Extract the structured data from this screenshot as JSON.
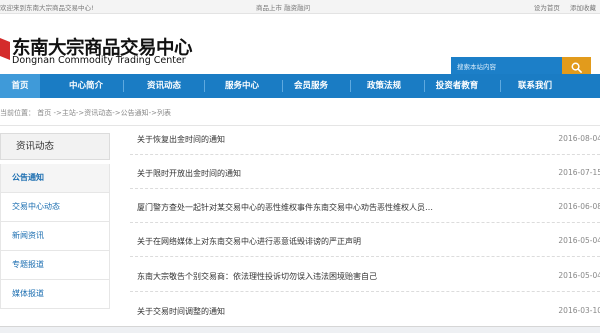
{
  "topbar": {
    "welcome": "欢迎来到东南大宗商品交易中心!",
    "center": "商品上市  融资融问",
    "links": [
      "设为首页",
      "添加收藏"
    ]
  },
  "header": {
    "logo_cn": "东南大宗商品交易中心",
    "logo_en": "Dongnan Commodity Trading Center",
    "search_placeholder": "搜索本站内容",
    "accent_color": "#1a7cc4",
    "search_button_color": "#e29b1c"
  },
  "nav": {
    "items": [
      {
        "label": "首页",
        "active": true
      },
      {
        "label": "中心简介"
      },
      {
        "label": "资讯动态"
      },
      {
        "label": "服务中心"
      },
      {
        "label": "会员服务"
      },
      {
        "label": "政策法规"
      },
      {
        "label": "投资者教育"
      },
      {
        "label": "联系我们"
      }
    ]
  },
  "breadcrumb": "当前位置：  首页 ->主站->资讯动态->公告通知->列表",
  "sidebar": {
    "title": "资讯动态",
    "items": [
      {
        "label": "公告通知",
        "active": true
      },
      {
        "label": "交易中心动态"
      },
      {
        "label": "新闻资讯"
      },
      {
        "label": "专题报道"
      },
      {
        "label": "媒体报道"
      }
    ]
  },
  "list": {
    "rows": [
      {
        "title": "关于恢复出金时间的通知",
        "date": "2016-08-04"
      },
      {
        "title": "关于限时开放出金时间的通知",
        "date": "2016-07-15"
      },
      {
        "title": "厦门警方查处一起针对某交易中心的恶性维权事件东南交易中心劝告恶性维权人员…",
        "date": "2016-06-08"
      },
      {
        "title": "关于在网络媒体上对东南交易中心进行恶意诋毁诽谤的严正声明",
        "date": "2016-05-04"
      },
      {
        "title": "东南大宗敬告个别交易商：依法理性投诉切勿误入违法困境贻害自己",
        "date": "2016-05-04"
      },
      {
        "title": "关于交易时间调整的通知",
        "date": "2016-03-10"
      }
    ]
  },
  "icons": {
    "search": "search-icon",
    "logo": "logo-icon"
  }
}
